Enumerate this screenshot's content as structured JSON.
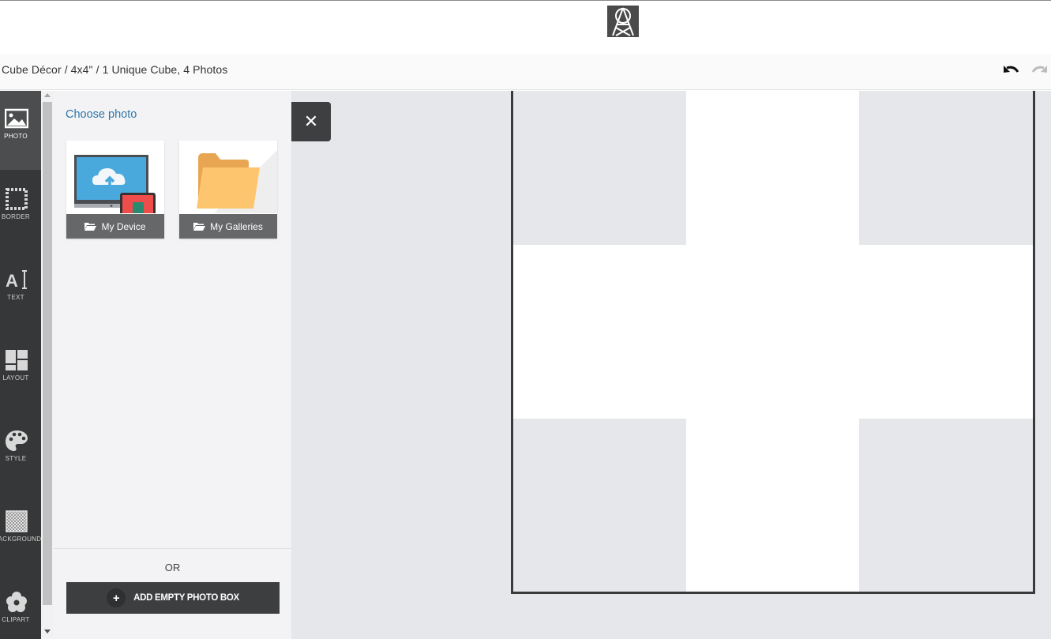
{
  "header": {
    "breadcrumb": "Cube Décor / 4x4\" / 1 Unique Cube, 4 Photos",
    "logo_icon": "tower-logo-icon"
  },
  "history": {
    "undo_icon": "undo-icon",
    "redo_icon": "redo-icon"
  },
  "toolbar": {
    "items": [
      {
        "label": "PHOTO",
        "icon": "photo-icon",
        "active": true
      },
      {
        "label": "BORDER",
        "icon": "border-icon"
      },
      {
        "label": "TEXT",
        "icon": "text-icon"
      },
      {
        "label": "LAYOUT",
        "icon": "layout-icon"
      },
      {
        "label": "STYLE",
        "icon": "palette-icon"
      },
      {
        "label": "BACKGROUND",
        "icon": "background-icon"
      },
      {
        "label": "CLIPART",
        "icon": "flower-icon"
      }
    ]
  },
  "panel": {
    "title": "Choose photo",
    "sources": [
      {
        "label": "My Device",
        "icon": "device-upload-icon"
      },
      {
        "label": "My Galleries",
        "icon": "folder-icon"
      }
    ],
    "or_text": "OR",
    "add_button": "ADD EMPTY PHOTO BOX"
  },
  "colors": {
    "accent": "#2d78a8",
    "toolbar": "#363738",
    "canvas_bg": "#e6e7ea"
  }
}
